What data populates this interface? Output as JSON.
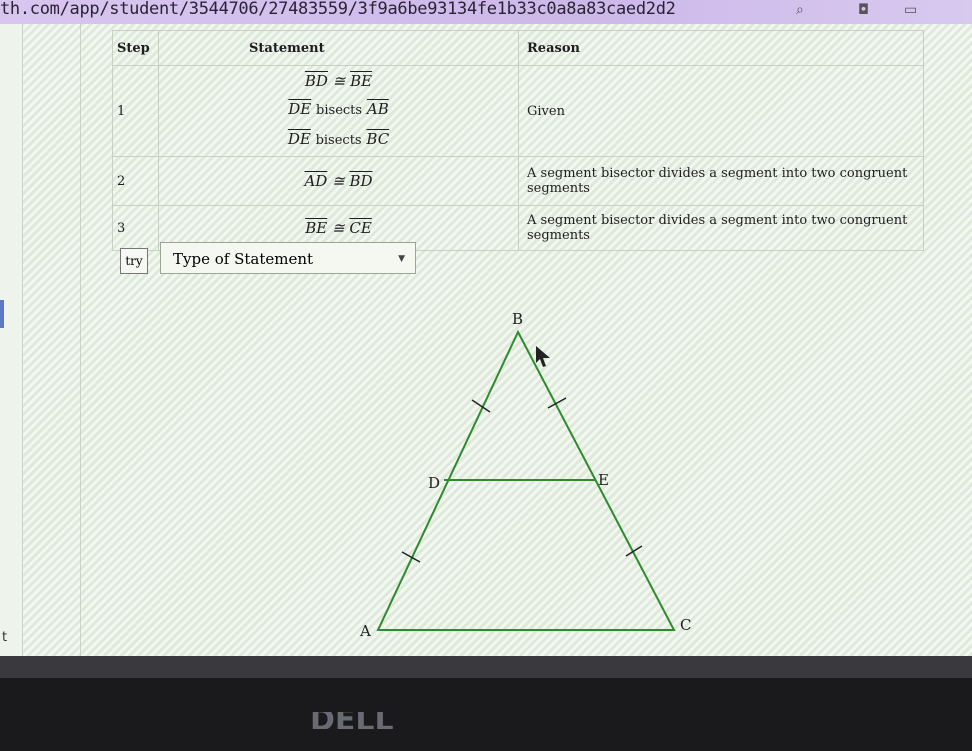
{
  "browser": {
    "url": "th.com/app/student/3544706/27483559/3f9a6be93134fe1b33c0a8a83caed2d2"
  },
  "proof": {
    "headers": {
      "step": "Step",
      "statement": "Statement",
      "reason": "Reason"
    },
    "rows": [
      {
        "step": "1",
        "statements": [
          {
            "a": "BD",
            "op": "≅",
            "b": "BE"
          },
          {
            "a": "DE",
            "op": "bisects",
            "b": "AB"
          },
          {
            "a": "DE",
            "op": "bisects",
            "b": "BC"
          }
        ],
        "reason": "Given"
      },
      {
        "step": "2",
        "statements": [
          {
            "a": "AD",
            "op": "≅",
            "b": "BD"
          }
        ],
        "reason": "A segment bisector divides a segment into two congruent segments"
      },
      {
        "step": "3",
        "statements": [
          {
            "a": "BE",
            "op": "≅",
            "b": "CE"
          }
        ],
        "reason": "A segment bisector divides a segment into two congruent segments"
      }
    ],
    "try_label": "try",
    "statement_type": "Type of Statement"
  },
  "diagram": {
    "labels": {
      "A": "A",
      "B": "B",
      "C": "C",
      "D": "D",
      "E": "E"
    }
  },
  "sidebar": {
    "fragment": "t"
  },
  "monitor": {
    "brand": "DELL"
  }
}
